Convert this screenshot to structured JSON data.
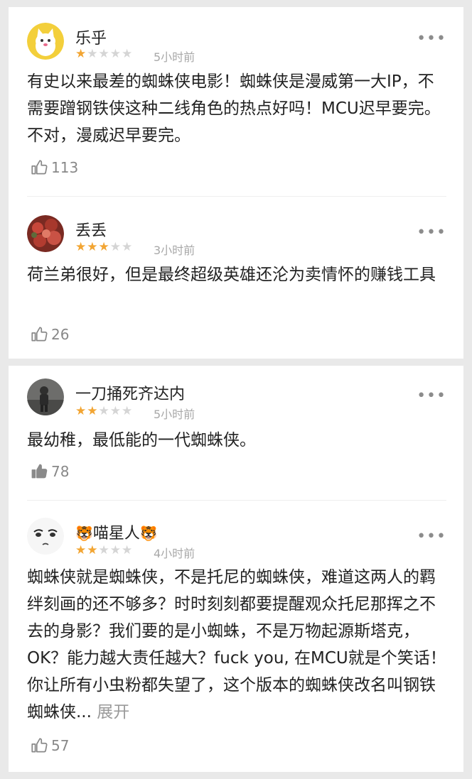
{
  "comments": [
    {
      "name": "乐乎",
      "stars": 1,
      "time": "5小时前",
      "text": "有史以来最差的蜘蛛侠电影！蜘蛛侠是漫威第一大IP，不需要蹭钢铁侠这种二线角色的热点好吗！MCU迟早要完。不对，漫威迟早要完。",
      "likes": "113",
      "liked": false
    },
    {
      "name": "丢丢",
      "stars": 3,
      "time": "3小时前",
      "text": "荷兰弟很好，但是最终超级英雄还沦为卖情怀的赚钱工具",
      "likes": "26",
      "liked": false
    },
    {
      "name": "一刀捅死齐达内",
      "stars": 2,
      "time": "5小时前",
      "text": "最幼稚，最低能的一代蜘蛛侠。",
      "likes": "78",
      "liked": true
    },
    {
      "name_prefix_emoji": "🐯",
      "name": "喵星人",
      "name_suffix_emoji": "🐯",
      "stars": 2,
      "time": "4小时前",
      "text": "蜘蛛侠就是蜘蛛侠，不是托尼的蜘蛛侠，难道这两人的羁绊刻画的还不够多？时时刻刻都要提醒观众托尼那挥之不去的身影？我们要的是小蜘蛛，不是万物起源斯塔克，OK？能力越大责任越大？fuck you, 在MCU就是个笑话！你让所有小虫粉都失望了，这个版本的蜘蛛侠改名叫钢铁蜘蛛侠...",
      "expand_label": "展开",
      "likes": "57",
      "liked": false
    }
  ],
  "more_label": "•••",
  "colors": {
    "star_on": "#f2a533",
    "star_off": "#d5d5d5",
    "muted": "#a8a8a8"
  }
}
